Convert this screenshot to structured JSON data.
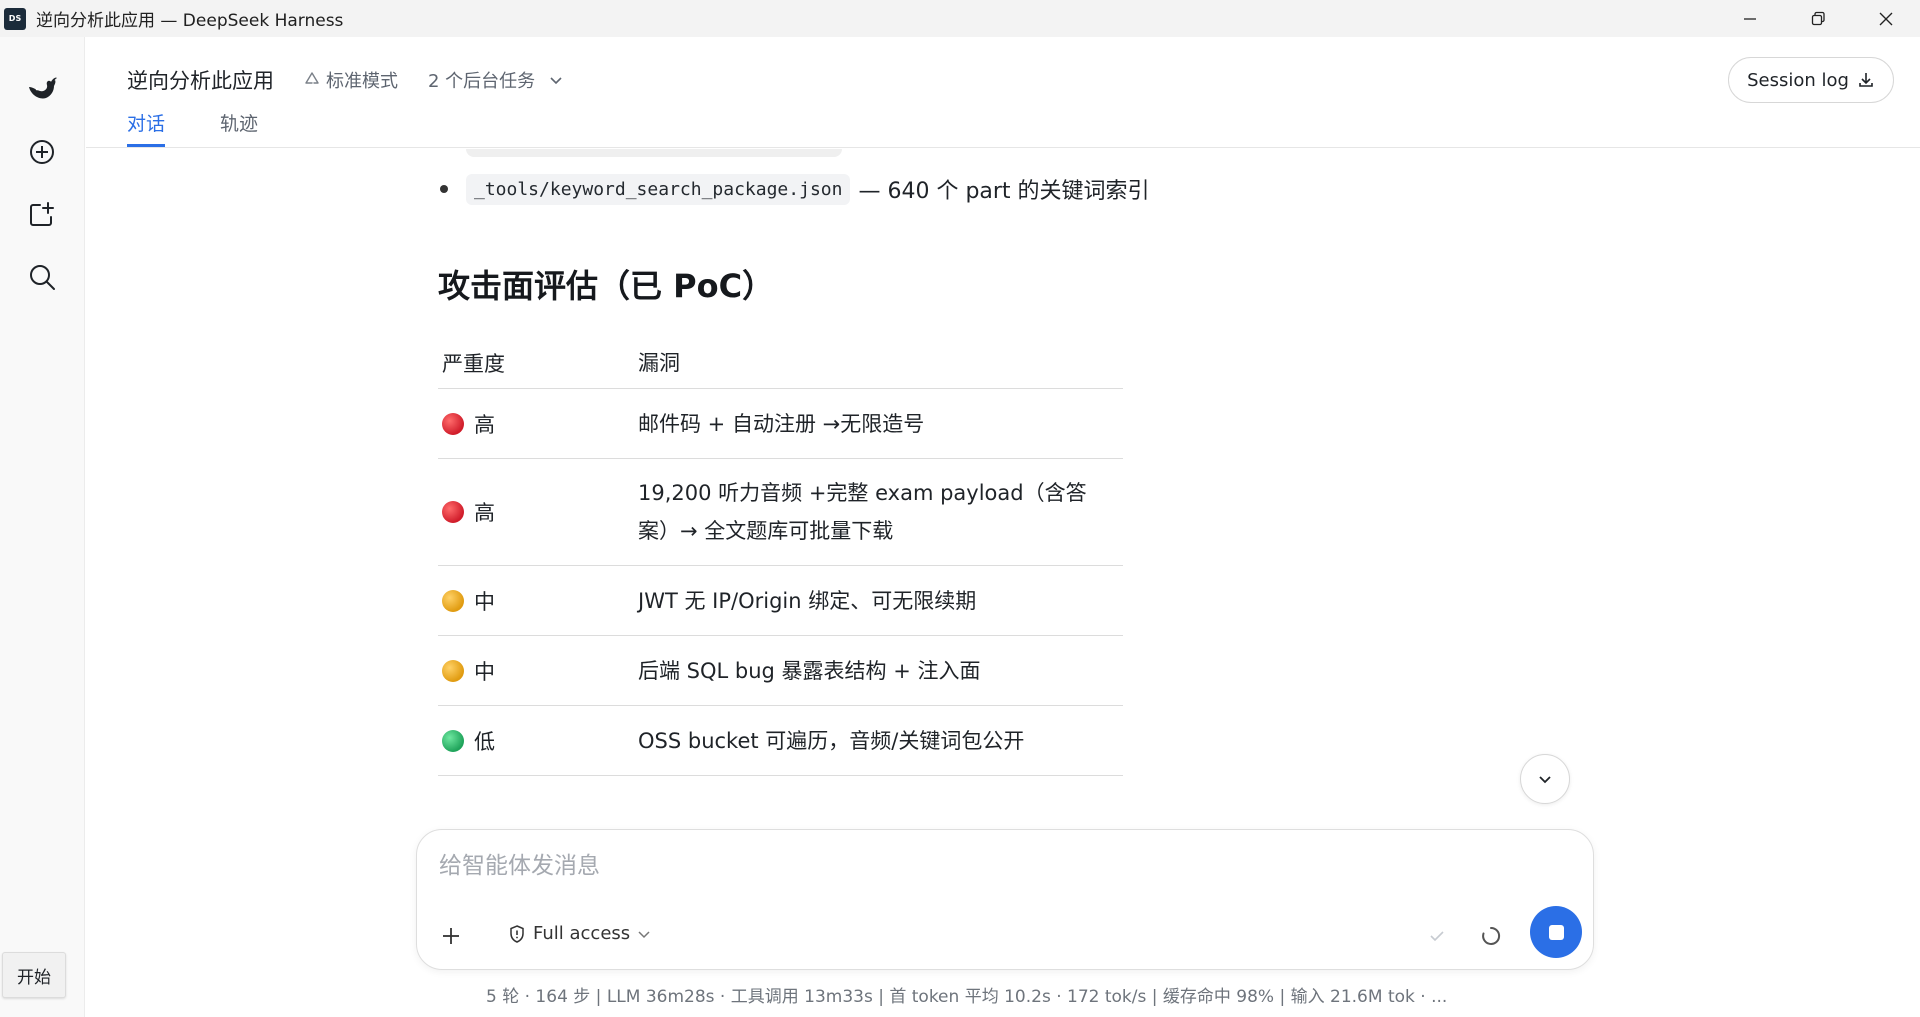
{
  "window": {
    "logo_text": "DS",
    "title": "逆向分析此应用 — DeepSeek Harness"
  },
  "sidebar": {
    "start_label": "开始"
  },
  "header": {
    "title": "逆向分析此应用",
    "mode": "标准模式",
    "tasks": "2 个后台任务",
    "tabs": [
      "对话",
      "轨迹"
    ],
    "session_log": "Session log"
  },
  "content": {
    "bullet": {
      "code": "_tools/keyword_search_package.json",
      "text": "— 640 个 part 的关键词索引"
    },
    "section_title": "攻击面评估（已 PoC）",
    "table": {
      "headers": [
        "严重度",
        "漏洞"
      ],
      "rows": [
        {
          "severity": "高",
          "color": "red",
          "vuln": "邮件码 + 自动注册 →无限造号"
        },
        {
          "severity": "高",
          "color": "red",
          "vuln": "19,200 听力音频 +完整 exam payload（含答案）→ 全文题库可批量下载"
        },
        {
          "severity": "中",
          "color": "yellow",
          "vuln": "JWT 无 IP/Origin 绑定、可无限续期"
        },
        {
          "severity": "中",
          "color": "yellow",
          "vuln": "后端 SQL bug 暴露表结构 + 注入面"
        },
        {
          "severity": "低",
          "color": "green",
          "vuln": "OSS bucket 可遍历，音频/关键词包公开"
        }
      ]
    }
  },
  "composer": {
    "placeholder": "给智能体发消息",
    "access_label": "Full access"
  },
  "status": "5 轮 · 164 步   |   LLM 36m28s · 工具调用 13m33s   |   首 token 平均 10.2s · 172 tok/s   |   缓存命中 98%   |   输入 21.6M tok · ...",
  "colors": {
    "accent": "#2b6fe6",
    "high": "#d01c2a",
    "medium": "#e09b10",
    "low": "#1fa35a"
  }
}
